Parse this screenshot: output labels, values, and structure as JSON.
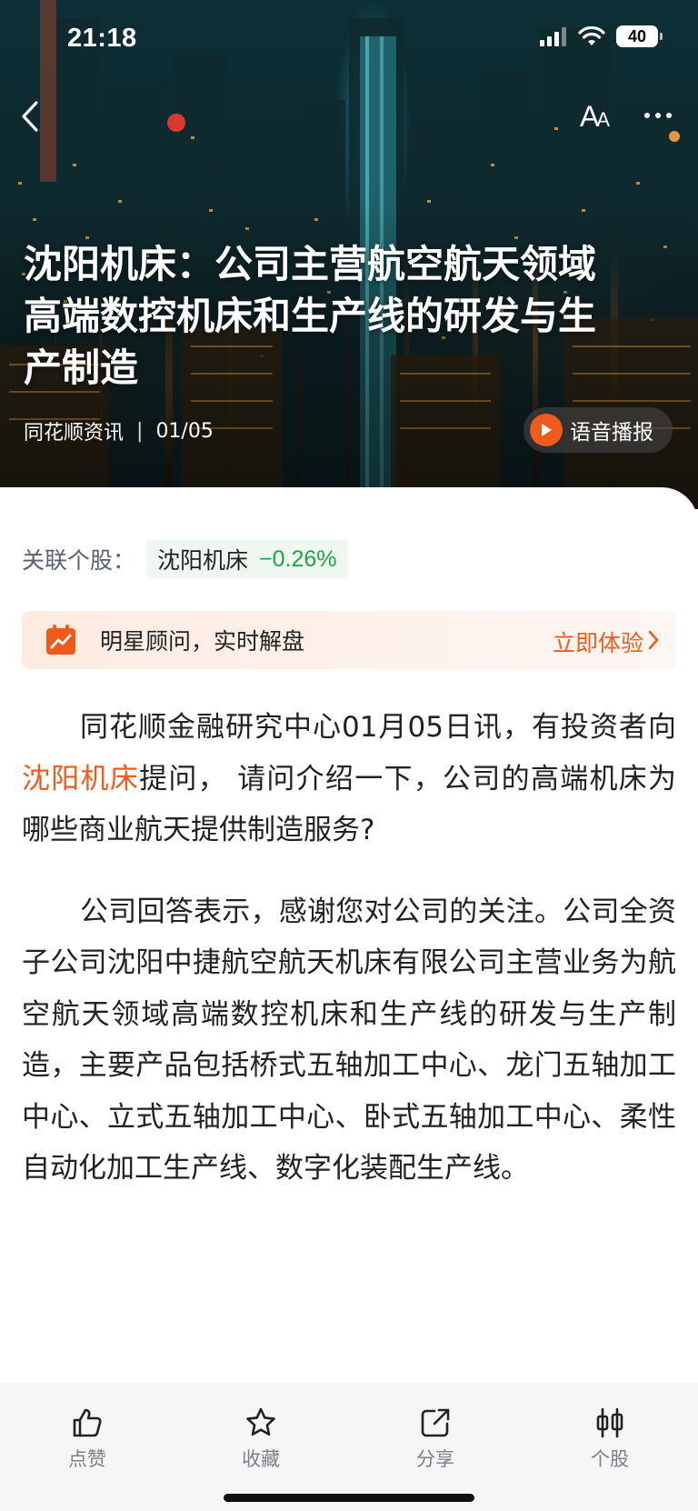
{
  "status_bar": {
    "time": "21:18",
    "battery": "40"
  },
  "header": {
    "font_button_big": "A",
    "font_button_small": "A"
  },
  "article": {
    "title": "沈阳机床：公司主营航空航天领域高端数控机床和生产线的研发与生产制造",
    "source": "同花顺资讯",
    "separator": "|",
    "date": "01/05",
    "voice_button": "语音播报",
    "related": {
      "label": "关联个股：",
      "stock_name": "沈阳机床",
      "stock_change": "−0.26%"
    },
    "promo": {
      "text": "明星顾问，实时解盘",
      "cta": "立即体验"
    },
    "paragraph1": {
      "part1": "同花顺金融研究中心01月05日讯，有投资者向",
      "stock_link": "沈阳机床",
      "part2": "提问，  请问介绍一下，公司的高端机床为哪些商业航天提供制造服务?"
    },
    "paragraph2": "公司回答表示，感谢您对公司的关注。公司全资子公司沈阳中捷航空航天机床有限公司主营业务为航空航天领域高端数控机床和生产线的研发与生产制造，主要产品包括桥式五轴加工中心、龙门五轴加工中心、立式五轴加工中心、卧式五轴加工中心、柔性自动化加工生产线、数字化装配生产线。"
  },
  "bottom_bar": [
    {
      "label": "点赞",
      "icon": "thumbs-up-icon"
    },
    {
      "label": "收藏",
      "icon": "star-icon"
    },
    {
      "label": "分享",
      "icon": "share-icon"
    },
    {
      "label": "个股",
      "icon": "stock-chart-icon"
    }
  ],
  "colors": {
    "accent": "#f05a1a",
    "gain_down": "#1aa64a",
    "text": "#222222"
  }
}
